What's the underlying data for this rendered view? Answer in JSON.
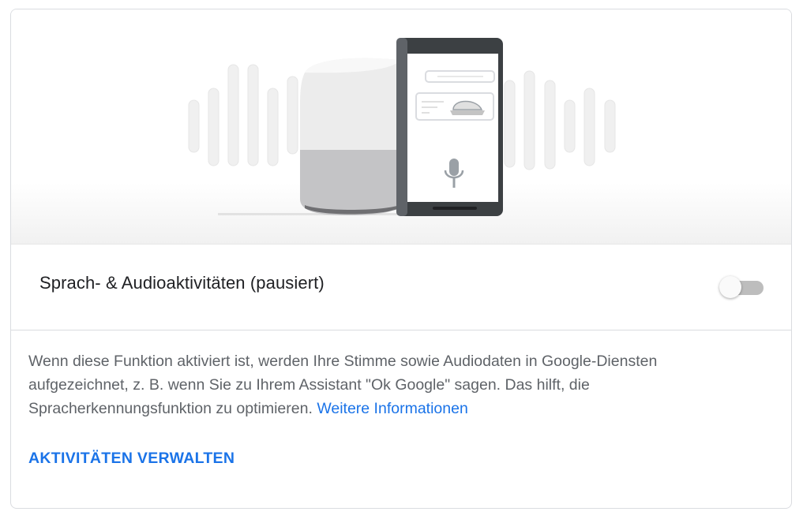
{
  "setting": {
    "title": "Sprach- & Audioaktivitäten (pausiert)",
    "enabled": false
  },
  "description": {
    "text": "Wenn diese Funktion aktiviert ist, werden Ihre Stimme sowie Audiodaten in Google-Diensten aufgezeichnet, z. B. wenn Sie zu Ihrem Assistant \"Ok Google\" sagen. Das hilft, die Spracherkennungsfunktion zu optimieren.",
    "learn_more_label": "Weitere Informationen"
  },
  "actions": {
    "manage_label": "AKTIVITÄTEN VERWALTEN"
  },
  "colors": {
    "accent": "#1a73e8",
    "title_text": "#202124",
    "body_text": "#5f6368",
    "toggle_off_track": "#bdbdbd"
  },
  "illustration": {
    "icons": [
      "smart-speaker-icon",
      "phone-icon",
      "microphone-icon",
      "sound-wave-icon"
    ]
  }
}
